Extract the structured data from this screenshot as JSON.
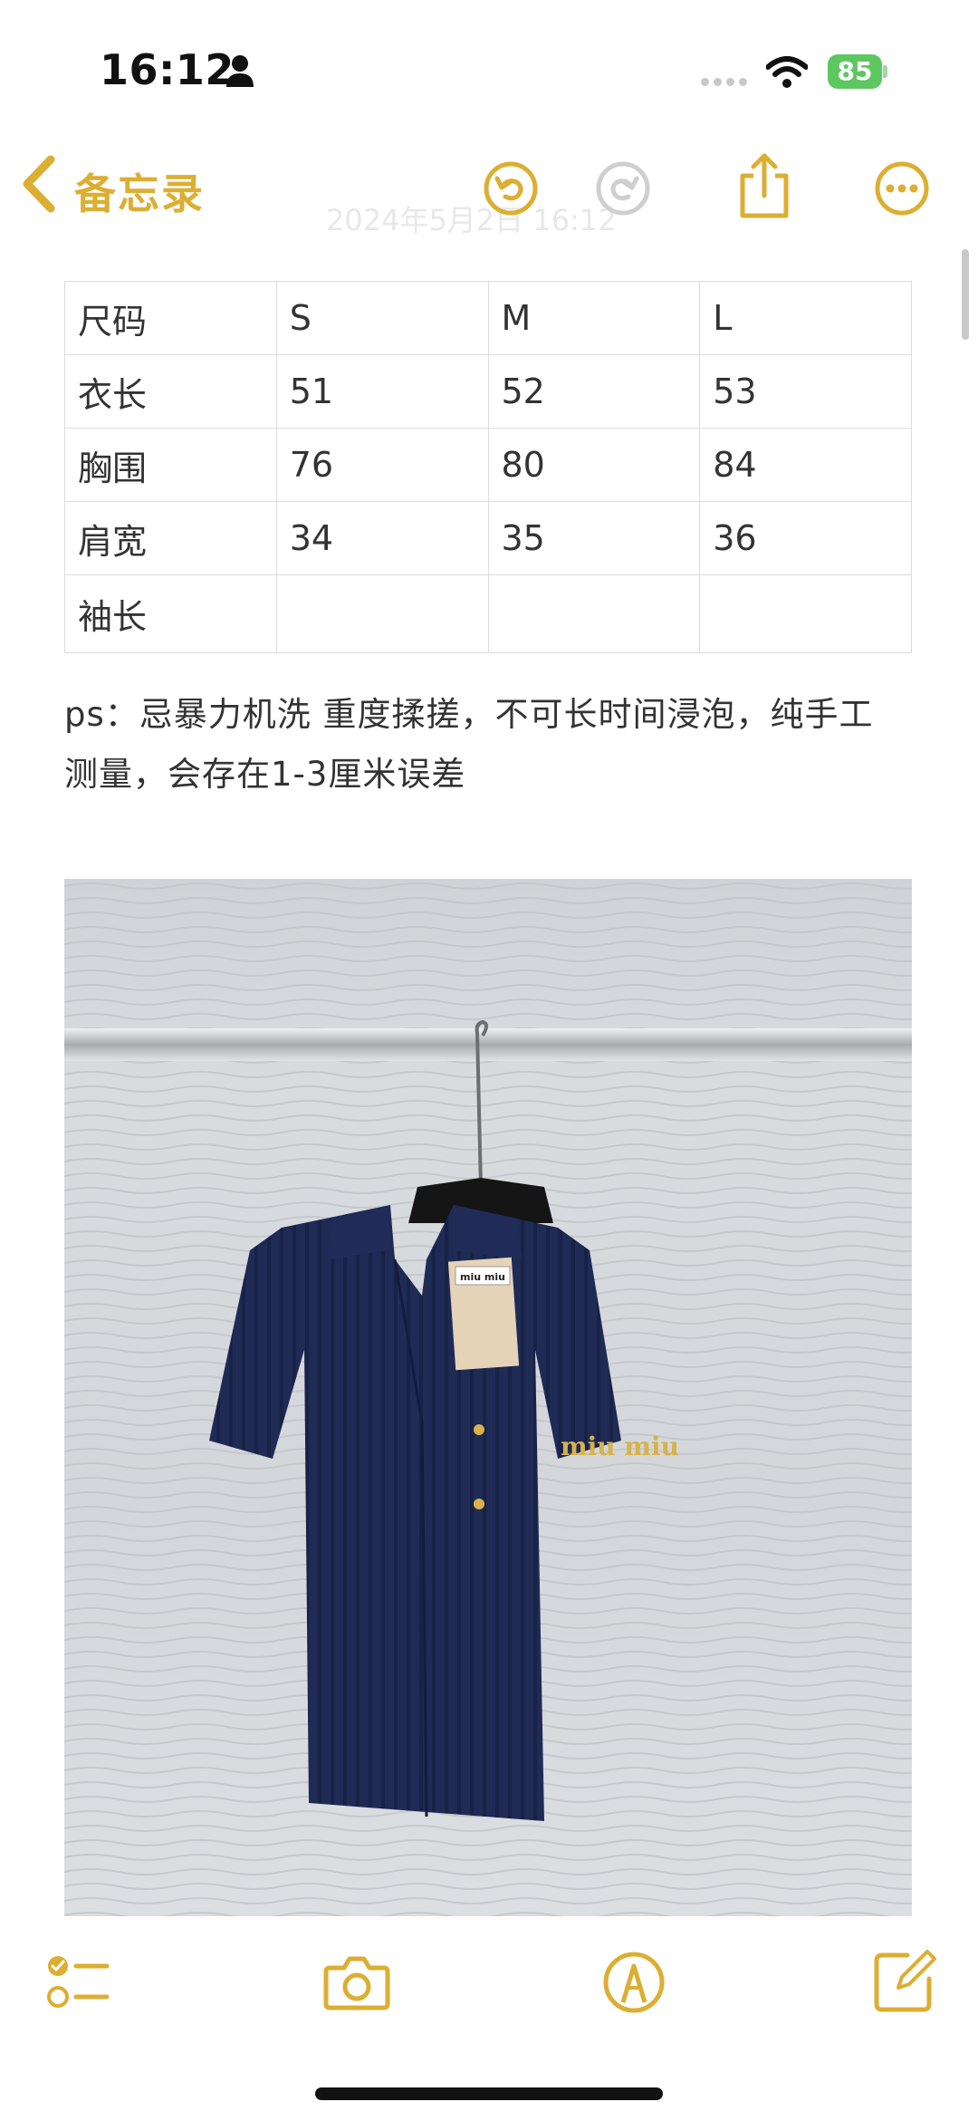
{
  "status_bar": {
    "time": "16:12",
    "battery_percent": "85"
  },
  "nav": {
    "back_label": "备忘录",
    "faded_date": "2024年5月2日 16:12",
    "actions": [
      "undo-icon",
      "redo-icon",
      "share-icon",
      "more-icon"
    ]
  },
  "table": {
    "rows": [
      [
        "尺码",
        "S",
        "M",
        "L"
      ],
      [
        "衣长",
        "51",
        "52",
        "53"
      ],
      [
        "胸围",
        "76",
        "80",
        "84"
      ],
      [
        "肩宽",
        "34",
        "35",
        "36"
      ],
      [
        "袖长",
        "",
        "",
        ""
      ]
    ]
  },
  "note": {
    "line1": "ps：忌暴力机洗 重度揉搓，不可长时间浸泡，纯手工",
    "line2": "测量，会存在1-3厘米误差"
  },
  "photo": {
    "tag_label": "miu miu",
    "embroidery": "miu miu",
    "colors": {
      "garment": "#1f2a55",
      "logo": "#d8b24a"
    }
  },
  "toolbar": {
    "items": [
      "checklist-icon",
      "camera-icon",
      "markup-icon",
      "compose-icon"
    ]
  },
  "colors": {
    "accent": "#dcae32",
    "text": "#333333",
    "grid": "#dddddd"
  }
}
